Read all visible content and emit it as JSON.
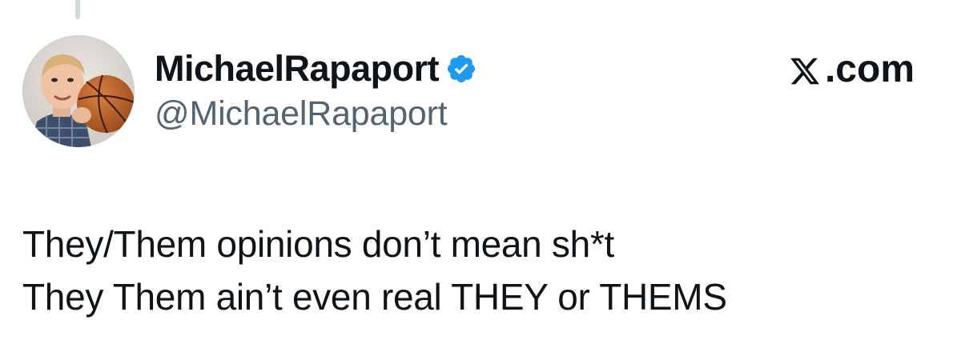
{
  "author": {
    "display_name": "MichaelRapaport",
    "handle": "@MichaelRapaport",
    "verified": true,
    "avatar": "profile-photo-with-basketball"
  },
  "brand": {
    "label": ".com",
    "logo": "x-logo-icon"
  },
  "tweet": {
    "lines": [
      "They/Them opinions don’t mean sh*t",
      "They Them ain’t even real THEY or THEMS"
    ]
  },
  "colors": {
    "text": "#0f1419",
    "secondary_text": "#536471",
    "verified_badge": "#1d9bf0",
    "thread_line": "#cfd9de",
    "background": "#ffffff"
  }
}
